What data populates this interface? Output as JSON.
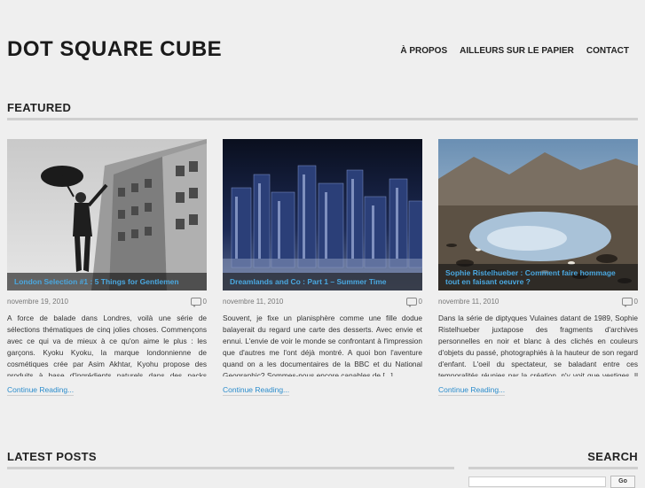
{
  "site": {
    "title": "DOT SQUARE CUBE"
  },
  "nav": {
    "items": [
      {
        "label": "À PROPOS"
      },
      {
        "label": "AILLEURS SUR LE PAPIER"
      },
      {
        "label": "CONTACT"
      }
    ]
  },
  "featured": {
    "heading": "FEATURED",
    "posts": [
      {
        "title": "London Selection #1 : 5 Things for Gentlemen",
        "date": "novembre 19, 2010",
        "comments": "0",
        "excerpt": "A force de balade dans Londres, voilà une série de sélections thématiques de cinq jolies choses. Commençons avec ce qui va de mieux à ce qu'on aime le plus : les garçons. Kyoku Kyoku, la marque londonnienne de cosmétiques crée par Asim Akhtar, Kyohu propose des produits à base d'ingrédients naturels dans des packs standards [...]",
        "more": "Continue Reading..."
      },
      {
        "title": "Dreamlands and Co : Part 1 – Summer Time",
        "date": "novembre 11, 2010",
        "comments": "0",
        "excerpt": "Souvent, je fixe un planisphère comme une fille dodue balayerait du regard une carte des desserts. Avec envie et ennui. L'envie de voir le monde se confrontant à l'impression que d'autres me l'ont déjà montré. A quoi bon l'aventure quand on a les documentaires de la BBC et du National Geographic? Sommes-nous encore capables de [...]",
        "more": "Continue Reading..."
      },
      {
        "title": "Sophie Ristelhueber : Comment faire hommage tout en faisant oeuvre ?",
        "date": "novembre 11, 2010",
        "comments": "0",
        "excerpt": "Dans la série de diptyques Vulaines datant de 1989, Sophie Ristelhueber juxtapose des fragments d'archives personnelles en noir et blanc à des clichés en couleurs d'objets du passé, photographiés à la hauteur de son regard d'enfant. L'oeil du spectateur, se baladant entre ces temporalités réunies par la création, n'y voit que vestiges. Il recherche les [...]",
        "more": "Continue Reading..."
      }
    ]
  },
  "latest": {
    "heading": "LATEST POSTS"
  },
  "search": {
    "heading": "SEARCH",
    "button": "Go"
  }
}
